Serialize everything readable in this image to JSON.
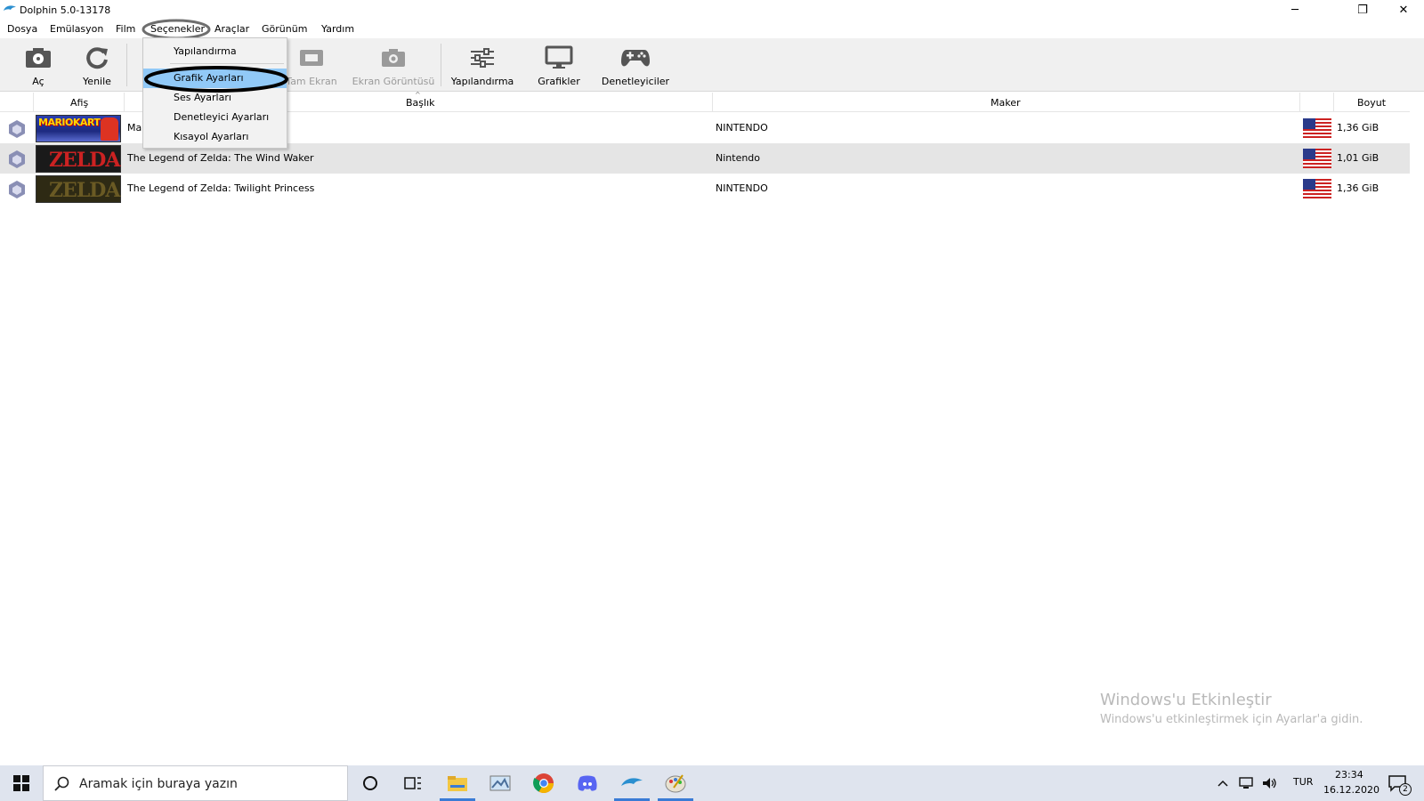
{
  "window": {
    "title": "Dolphin 5.0-13178",
    "minimize": "─",
    "restore": "❐",
    "close": "✕"
  },
  "menu": [
    "Dosya",
    "Emülasyon",
    "Film",
    "Seçenekler",
    "Araçlar",
    "Görünüm",
    "Yardım"
  ],
  "toolbar": {
    "open": "Aç",
    "refresh": "Yenile",
    "fullscreen": "Tam Ekran",
    "screenshot": "Ekran Görüntüsü",
    "config": "Yapılandırma",
    "graphics": "Grafikler",
    "controllers": "Denetleyiciler"
  },
  "columns": {
    "banner": "Afiş",
    "title": "Başlık",
    "maker": "Maker",
    "size": "Boyut"
  },
  "games": [
    {
      "title": "Ma",
      "maker": "NINTENDO",
      "size": "1,36 GiB",
      "banner": "MARIOKART"
    },
    {
      "title": "The Legend of Zelda: The Wind Waker",
      "maker": "Nintendo",
      "size": "1,01 GiB",
      "banner": "ZELDA"
    },
    {
      "title": "The Legend of Zelda: Twilight Princess",
      "maker": "NINTENDO",
      "size": "1,36 GiB",
      "banner": "ZELDA"
    }
  ],
  "dropdown": {
    "items": [
      "Yapılandırma",
      "Grafik Ayarları",
      "Ses Ayarları",
      "Denetleyici Ayarları",
      "Kısayol Ayarları"
    ],
    "highlighted": "Grafik Ayarları"
  },
  "watermark": {
    "line1": "Windows'u Etkinleştir",
    "line2": "Windows'u etkinleştirmek için Ayarlar'a gidin."
  },
  "taskbar": {
    "search_placeholder": "Aramak için buraya yazın",
    "lang": "TUR",
    "time": "23:34",
    "date": "16.12.2020",
    "notifications": "2"
  },
  "colors": {
    "highlight": "#91c9f7",
    "annotation": "#000000",
    "selected_row": "#e5e5e5"
  }
}
